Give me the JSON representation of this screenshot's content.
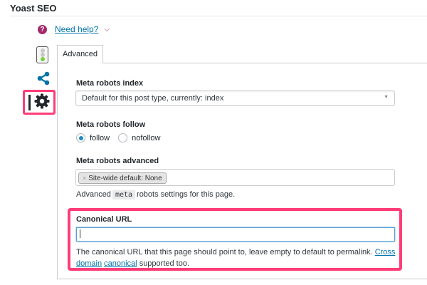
{
  "panel": {
    "title": "Yoast SEO"
  },
  "help": {
    "icon": "question-icon",
    "link_text": "Need help?",
    "chevron": "⌄"
  },
  "side_tabs": [
    {
      "icon": "traffic-light-icon",
      "active": false
    },
    {
      "icon": "share-icon",
      "active": false
    },
    {
      "icon": "gear-icon",
      "active": true
    }
  ],
  "tab": {
    "label": "Advanced"
  },
  "fields": {
    "robots_index": {
      "label": "Meta robots index",
      "value": "Default for this post type, currently: index"
    },
    "robots_follow": {
      "label": "Meta robots follow",
      "options": [
        {
          "label": "follow",
          "checked": true
        },
        {
          "label": "nofollow",
          "checked": false
        }
      ]
    },
    "robots_advanced": {
      "label": "Meta robots advanced",
      "chip": "Site-wide default: None",
      "chip_remove": "×",
      "desc_before": "Advanced",
      "desc_code": "meta",
      "desc_after": "robots settings for this page."
    },
    "canonical": {
      "label": "Canonical URL",
      "value": "",
      "desc_text": "The canonical URL that this page should point to, leave empty to default to permalink.",
      "desc_link_1": "Cross domain",
      "desc_link_2": "canonical",
      "desc_tail": "supported too."
    }
  },
  "colors": {
    "highlight": "#ff3c78",
    "link": "#0073aa",
    "brand": "#a4286a"
  }
}
